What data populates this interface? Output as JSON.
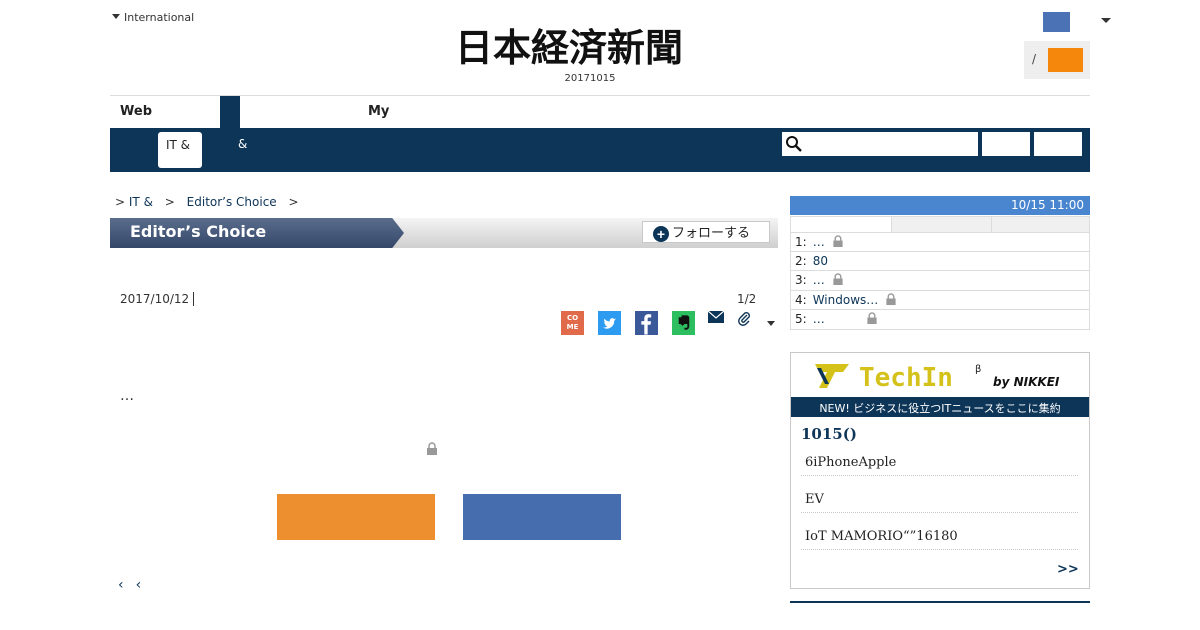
{
  "header": {
    "international_label": "International",
    "masthead": "日本経済新聞",
    "edition_date": "20171015",
    "login_separator": "/"
  },
  "nav": {
    "web_label": "Web",
    "my_label": "My",
    "sub_it": "IT &",
    "sub_amp": "&"
  },
  "breadcrumb": {
    "sep1": ">",
    "item1": "IT &",
    "sep2": ">",
    "item2": "Editor’s Choice",
    "sep3": ">"
  },
  "column": {
    "title": "Editor’s Choice",
    "follow_label": "フォローする"
  },
  "article": {
    "date": "2017/10/12",
    "page_indicator": "1/2",
    "body_ellipsis": "…",
    "share_come_label": "CO\nME"
  },
  "pager": {
    "prev1": "‹",
    "prev2": "‹"
  },
  "ranking": {
    "timestamp": "10/15 11:00",
    "items": [
      {
        "rank": "1:",
        "title": "…",
        "locked": true
      },
      {
        "rank": "2:",
        "title": "80",
        "locked": false
      },
      {
        "rank": "3:",
        "title": "…",
        "locked": true
      },
      {
        "rank": "4:",
        "title": "Windows…",
        "locked": true
      },
      {
        "rank": "5:",
        "title": "…",
        "locked": true
      }
    ]
  },
  "techin": {
    "logo_text": "TechIn",
    "logo_beta": "β",
    "logo_by": "by NIKKEI",
    "tagline": "NEW! ビジネスに役立つITニュースをここに集約",
    "date_heading": "1015()",
    "items": [
      "6iPhoneApple",
      "EV",
      "IoT MAMORIO“”16180"
    ],
    "more_label": ">>"
  },
  "colors": {
    "navy": "#0d3558",
    "accent_orange": "#f5880c",
    "accent_blue": "#4a72b5",
    "ranking_header": "#4a86d0",
    "cta_orange": "#ed8f2e",
    "cta_blue": "#466eaf",
    "techin_yellow": "#d4c21a"
  }
}
